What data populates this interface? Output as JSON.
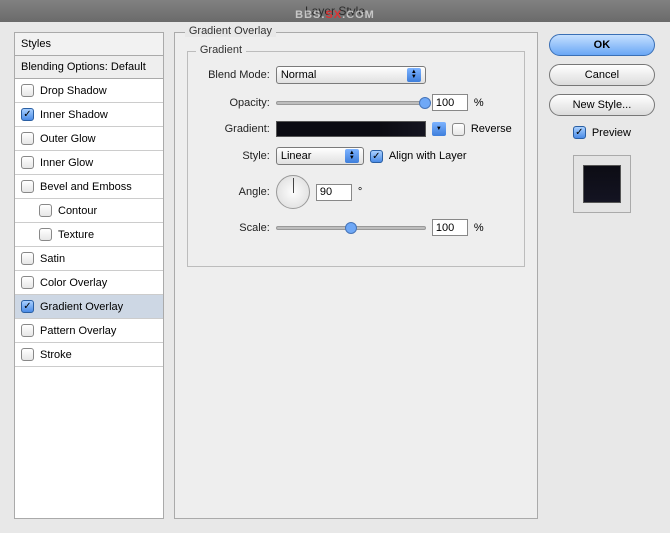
{
  "window": {
    "title": "Layer Style"
  },
  "watermark": {
    "left": "BBS.",
    "center": "SX",
    "right": ".COM"
  },
  "sidebar": {
    "header": "Styles",
    "sub": "Blending Options: Default",
    "items": [
      {
        "label": "Drop Shadow",
        "checked": false,
        "indent": false
      },
      {
        "label": "Inner Shadow",
        "checked": true,
        "indent": false
      },
      {
        "label": "Outer Glow",
        "checked": false,
        "indent": false
      },
      {
        "label": "Inner Glow",
        "checked": false,
        "indent": false
      },
      {
        "label": "Bevel and Emboss",
        "checked": false,
        "indent": false
      },
      {
        "label": "Contour",
        "checked": false,
        "indent": true
      },
      {
        "label": "Texture",
        "checked": false,
        "indent": true
      },
      {
        "label": "Satin",
        "checked": false,
        "indent": false
      },
      {
        "label": "Color Overlay",
        "checked": false,
        "indent": false
      },
      {
        "label": "Gradient Overlay",
        "checked": true,
        "indent": false,
        "selected": true
      },
      {
        "label": "Pattern Overlay",
        "checked": false,
        "indent": false
      },
      {
        "label": "Stroke",
        "checked": false,
        "indent": false
      }
    ]
  },
  "settings": {
    "group_title": "Gradient Overlay",
    "fieldset_title": "Gradient",
    "blend_mode": {
      "label": "Blend Mode:",
      "value": "Normal"
    },
    "opacity": {
      "label": "Opacity:",
      "value": "100",
      "unit": "%",
      "slider_pct": 100
    },
    "gradient": {
      "label": "Gradient:",
      "reverse_label": "Reverse",
      "reverse_checked": false
    },
    "style": {
      "label": "Style:",
      "value": "Linear",
      "align_label": "Align with Layer",
      "align_checked": true
    },
    "angle": {
      "label": "Angle:",
      "value": "90",
      "unit": "°"
    },
    "scale": {
      "label": "Scale:",
      "value": "100",
      "unit": "%",
      "slider_pct": 50
    }
  },
  "buttons": {
    "ok": "OK",
    "cancel": "Cancel",
    "new_style": "New Style...",
    "preview_label": "Preview",
    "preview_checked": true
  }
}
